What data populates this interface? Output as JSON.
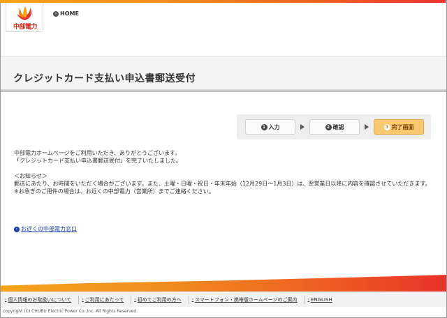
{
  "header": {
    "logo_text": "中部電力",
    "home_label": "HOME"
  },
  "page": {
    "title": "クレジットカード支払い申込書郵送受付"
  },
  "steps": [
    {
      "num": "1",
      "label": "入力"
    },
    {
      "num": "2",
      "label": "確認"
    },
    {
      "num": "3",
      "label": "完了画面"
    }
  ],
  "content": {
    "line1": "中部電力ホームページをご利用いただき、ありがとうございます。",
    "line2": "「クレジットカード支払い申込書郵送受付」を完了いたしました。",
    "notice_heading": "＜お知らせ＞",
    "notice1": "郵送にあたり、お時間をいただく場合がございます。また、土曜・日曜・祝日・年末年始（12月29日～1月3日）は、翌営業日以降に内容を確認させていただきます。",
    "notice2": "※お急ぎのご用件の場合は、お近くの中部電力（営業所）までご連絡ください。",
    "near_link": "お近くの中部電力窓口"
  },
  "footer": {
    "nav": [
      "個人情報のお取扱いについて",
      "ご利用にあたって",
      "初めてご利用の方へ",
      "スマートフォン・携帯版ホームページのご案内",
      "ENGLISH"
    ],
    "copyright": "copyright (C) CHUBU Electric Power Co.,Inc. All Rights Reserved."
  },
  "colors": {
    "brand_red": "#d7261c",
    "accent_orange": "#f08a1e",
    "active_step": "#f9c86f"
  }
}
